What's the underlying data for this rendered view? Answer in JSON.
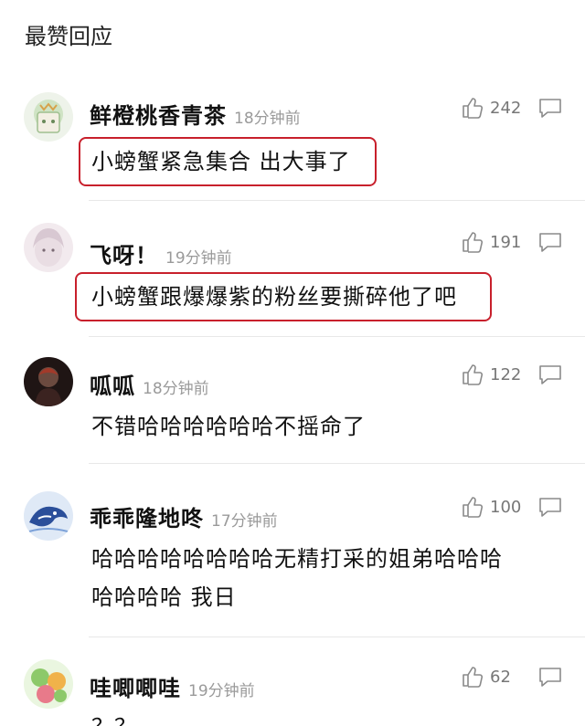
{
  "section": {
    "title": "最赞回应"
  },
  "comments": [
    {
      "username": "鲜橙桃香青茶",
      "time": "18分钟前",
      "likes": "242",
      "text": "小螃蟹紧急集合 出大事了",
      "avatar_color": "#cfe3c4"
    },
    {
      "username": "飞呀！",
      "time": "19分钟前",
      "likes": "191",
      "text": "小螃蟹跟爆爆紫的粉丝要撕碎他了吧",
      "avatar_color": "#e9dde3"
    },
    {
      "username": "呱呱",
      "time": "18分钟前",
      "likes": "122",
      "text": "不错哈哈哈哈哈哈不摇命了",
      "avatar_color": "#3b2320"
    },
    {
      "username": "乖乖隆地咚",
      "time": "17分钟前",
      "likes": "100",
      "text_line1": "哈哈哈哈哈哈哈哈无精打采的姐弟哈哈哈",
      "text_line2": "哈哈哈哈 我日",
      "avatar_color": "#2b4f9a"
    },
    {
      "username": "哇唧唧哇",
      "time": "19分钟前",
      "likes": "62",
      "text": "？？",
      "avatar_color": "#8dc96a"
    }
  ],
  "colors": {
    "highlight": "#c8202c",
    "muted": "#9a9a9a"
  },
  "icons": {
    "like": "thumbs-up-icon",
    "reply": "comment-bubble-icon"
  }
}
